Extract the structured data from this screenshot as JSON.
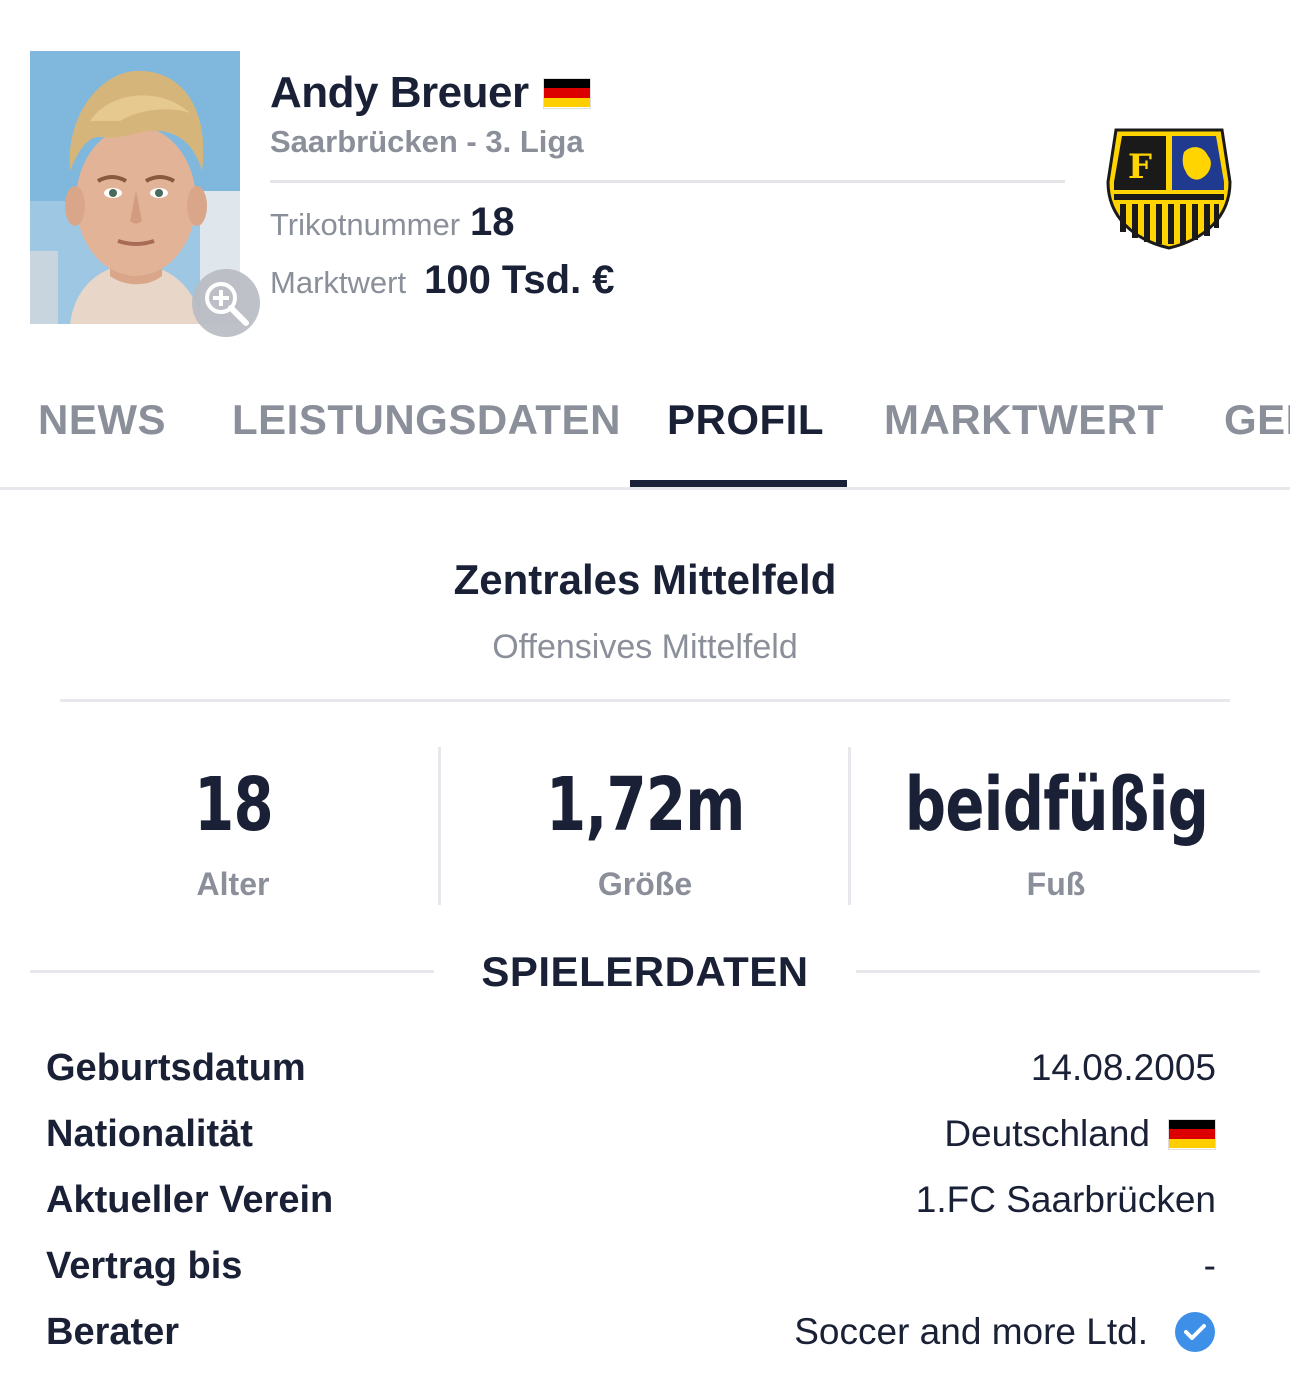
{
  "player": {
    "name": "Andy Breuer",
    "club_league": "Saarbrücken - 3. Liga",
    "jersey_label": "Trikotnummer",
    "jersey_number": "18",
    "market_value_label": "Marktwert",
    "market_value": "100 Tsd. €"
  },
  "tabs": [
    {
      "label": "NEWS"
    },
    {
      "label": "LEISTUNGSDATEN"
    },
    {
      "label": "PROFIL"
    },
    {
      "label": "MARKTWERT"
    },
    {
      "label": "GEI"
    }
  ],
  "position": {
    "main": "Zentrales Mittelfeld",
    "secondary": "Offensives Mittelfeld"
  },
  "stats": [
    {
      "value": "18",
      "label": "Alter"
    },
    {
      "value": "1,72m",
      "label": "Größe"
    },
    {
      "value": "beidfüßig",
      "label": "Fuß"
    }
  ],
  "section": {
    "title": "SPIELERDATEN"
  },
  "details": [
    {
      "label": "Geburtsdatum",
      "value": "14.08.2005"
    },
    {
      "label": "Nationalität",
      "value": "Deutschland"
    },
    {
      "label": "Aktueller Verein",
      "value": "1.FC Saarbrücken"
    },
    {
      "label": "Vertrag bis",
      "value": "-"
    },
    {
      "label": "Berater",
      "value": "Soccer and more Ltd."
    }
  ],
  "colors": {
    "text_primary": "#1a2035",
    "text_muted": "#8a8f99",
    "club_yellow": "#ffd400",
    "club_blue": "#1f3a8f",
    "verified_blue": "#3d8fe8"
  },
  "icons": {
    "zoom": "zoom-in-icon",
    "flag": "germany-flag-icon",
    "club": "club-logo",
    "verified": "verified-check-icon"
  }
}
